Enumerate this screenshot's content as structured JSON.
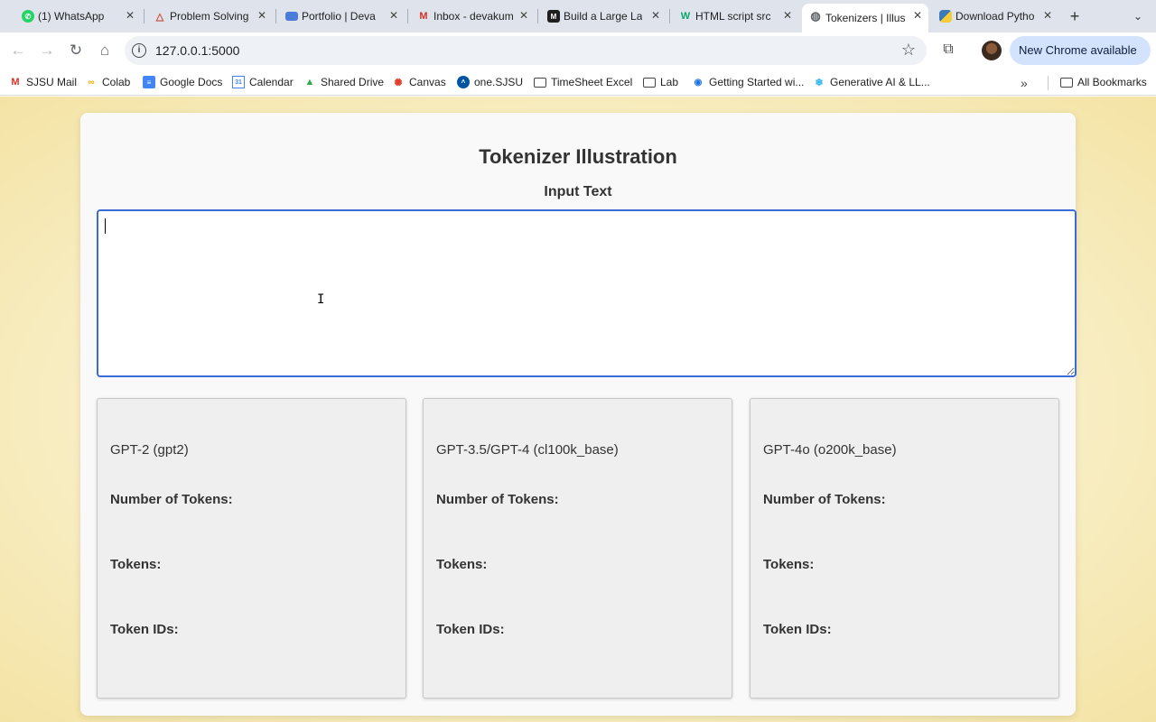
{
  "browser": {
    "tabs": [
      {
        "label": "(1) WhatsApp",
        "icon": "whatsapp-icon"
      },
      {
        "label": "Problem Solving",
        "icon": "triangle-icon"
      },
      {
        "label": "Portfolio | Deva",
        "icon": "monitor-icon"
      },
      {
        "label": "Inbox - devakum",
        "icon": "gmail-icon"
      },
      {
        "label": "Build a Large La",
        "icon": "book-icon"
      },
      {
        "label": "HTML script src",
        "icon": "w3-icon"
      },
      {
        "label": "Tokenizers | Illus",
        "icon": "globe-icon",
        "active": true
      },
      {
        "label": "Download Pytho",
        "icon": "python-icon"
      }
    ],
    "url": "127.0.0.1:5000",
    "update_label": "New Chrome available",
    "bookmarks": [
      {
        "label": "SJSU Mail",
        "icon": "gmail-icon"
      },
      {
        "label": "Colab",
        "icon": "colab-icon"
      },
      {
        "label": "Google Docs",
        "icon": "docs-icon"
      },
      {
        "label": "Calendar",
        "icon": "calendar-icon"
      },
      {
        "label": "Shared Drive",
        "icon": "drive-icon"
      },
      {
        "label": "Canvas",
        "icon": "canvas-icon"
      },
      {
        "label": "one.SJSU",
        "icon": "one-sjsu-icon"
      },
      {
        "label": "TimeSheet Excel",
        "icon": "folder-icon"
      },
      {
        "label": "Lab",
        "icon": "folder-icon"
      },
      {
        "label": "Getting Started wi...",
        "icon": "dot-icon"
      },
      {
        "label": "Generative AI & LL...",
        "icon": "snowflake-icon"
      }
    ],
    "all_bookmarks_label": "All Bookmarks"
  },
  "page": {
    "title": "Tokenizer Illustration",
    "input_label": "Input Text",
    "input_value": "",
    "labels": {
      "count": "Number of Tokens:",
      "tokens": "Tokens:",
      "ids": "Token IDs:"
    },
    "cards": [
      {
        "model": "GPT-2 (gpt2)"
      },
      {
        "model": "GPT-3.5/GPT-4 (cl100k_base)"
      },
      {
        "model": "GPT-4o (o200k_base)"
      }
    ]
  },
  "colors": {
    "accent": "#3b6bd6",
    "page_background": "#f8eec4",
    "card_background": "#efefef"
  }
}
